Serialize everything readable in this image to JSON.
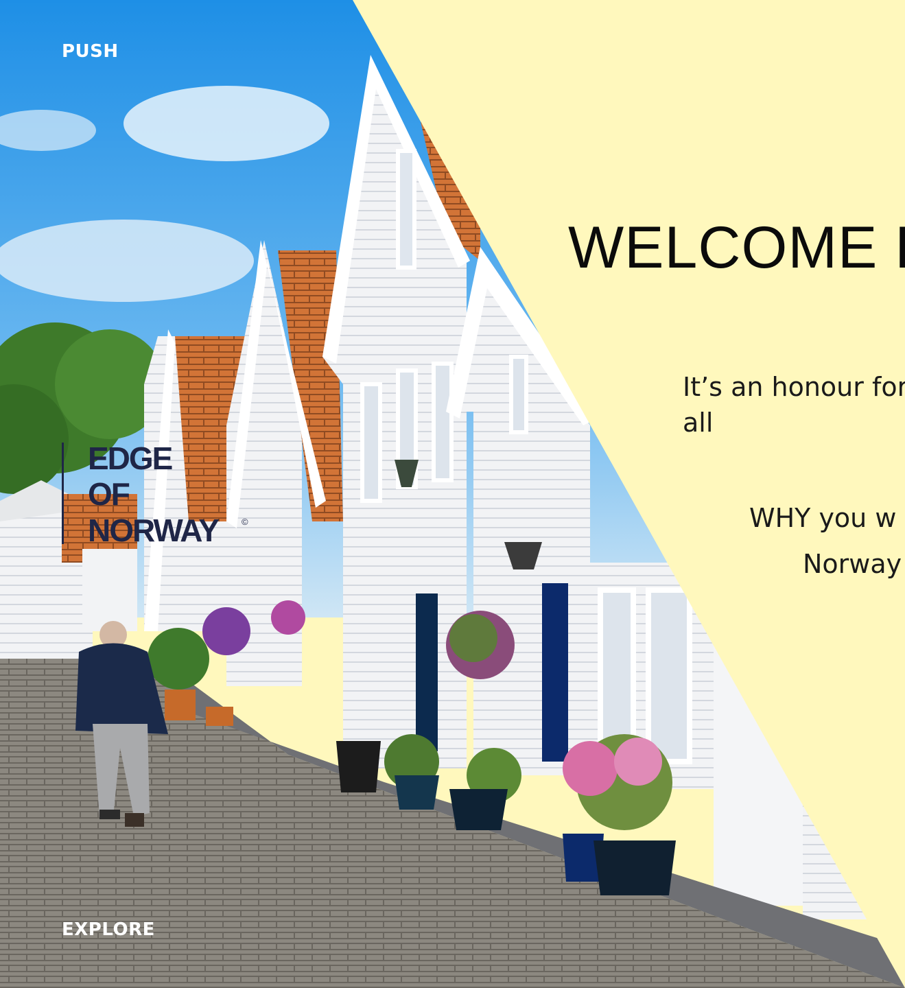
{
  "slide": {
    "corner_top_label": "PUSH",
    "corner_bottom_label": "EXPLORE",
    "logo": {
      "line1": "EDGE",
      "line2": "OF",
      "line3": "NORWAY",
      "mark": "©"
    },
    "title": "WELCOME E",
    "text_honour": "It’s an honour for all",
    "text_why": "WHY you w",
    "text_norway": "Norway"
  },
  "photo": {
    "description_icon": "street-of-white-wooden-houses-image"
  },
  "colors": {
    "panel": "#fff8bd",
    "sky": "#2a9be8",
    "logo_navy": "#1f2647",
    "roof_tile": "#d8783a",
    "door_blue": "#0c2a6b"
  }
}
